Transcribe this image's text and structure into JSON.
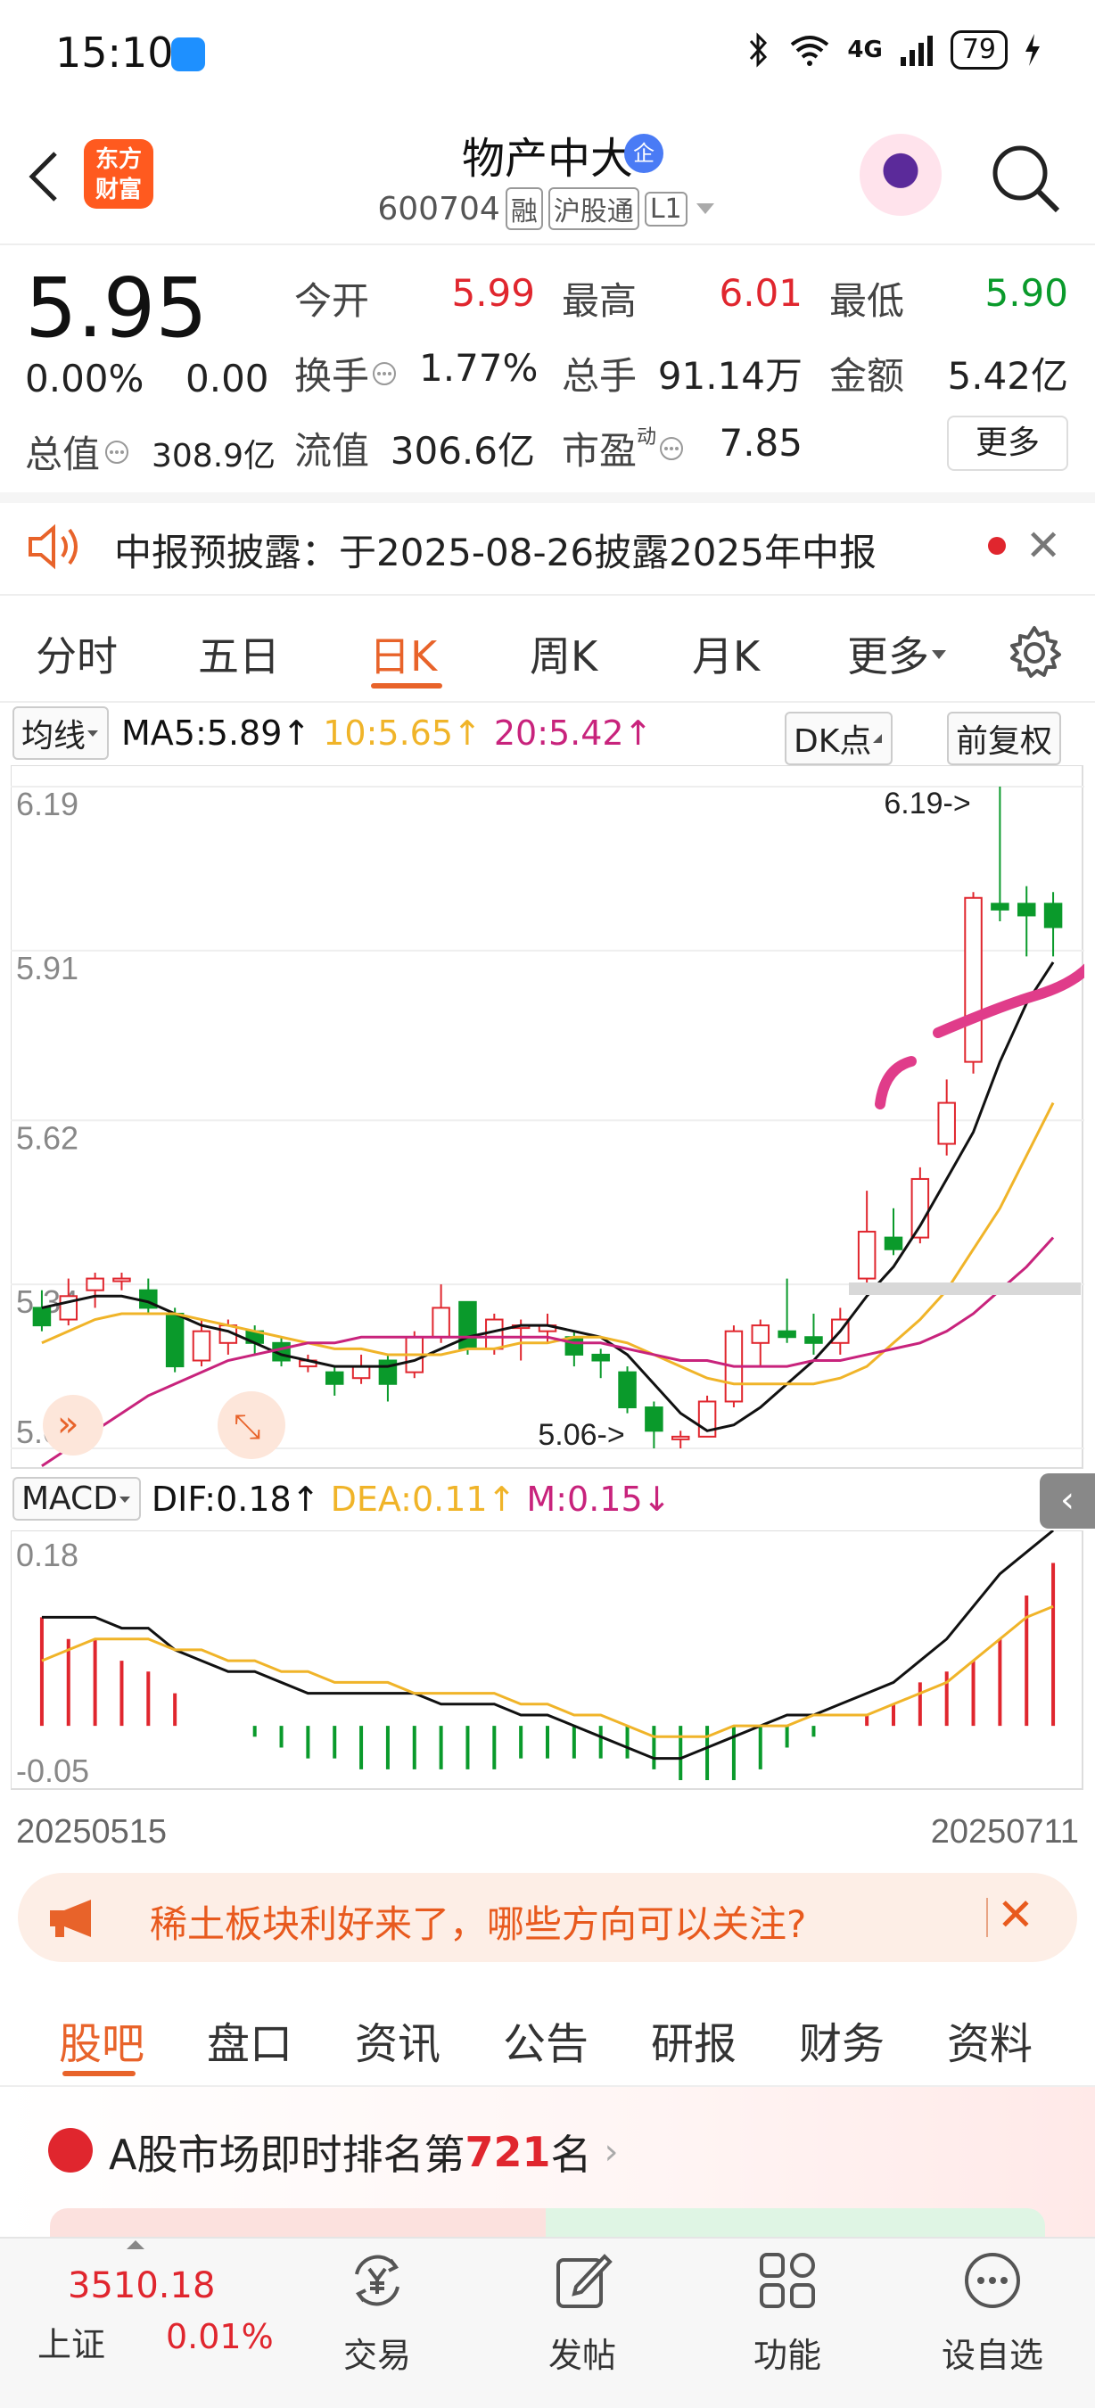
{
  "status_bar": {
    "time": "15:10",
    "network": "4G",
    "battery": "79"
  },
  "header": {
    "logo_line1": "东方",
    "logo_line2": "财富",
    "stock_name": "物产中大",
    "ent_badge": "企",
    "stock_code": "600704",
    "tags": [
      "融",
      "沪股通",
      "L1"
    ]
  },
  "quote": {
    "price": "5.95",
    "change_pct": "0.00%",
    "change_amt": "0.00",
    "open_label": "今开",
    "open": "5.99",
    "high_label": "最高",
    "high": "6.01",
    "low_label": "最低",
    "low": "5.90",
    "turnover_label": "换手",
    "turnover": "1.77%",
    "volume_label": "总手",
    "volume": "91.14万",
    "amount_label": "金额",
    "amount": "5.42亿",
    "total_cap_label": "总值",
    "total_cap": "308.9亿",
    "float_cap_label": "流值",
    "float_cap": "306.6亿",
    "pe_label": "市盈",
    "pe_sup": "动",
    "pe": "7.85",
    "more": "更多"
  },
  "notice": {
    "text": "中报预披露：于2025-08-26披露2025年中报"
  },
  "period_tabs": [
    "分时",
    "五日",
    "日K",
    "周K",
    "月K",
    "更多"
  ],
  "period_active": "日K",
  "ma_bar": {
    "selector": "均线",
    "ma5": "MA5:5.89↑",
    "ma10": "10:5.65↑",
    "ma20": "20:5.42↑",
    "dk": "DK点",
    "adjust": "前复权"
  },
  "colors": {
    "up": "#e0262e",
    "down": "#0a9a2b",
    "ma5": "#111111",
    "ma10": "#f0b429",
    "ma20": "#c8237c",
    "accent": "#e8632a"
  },
  "chart_data": [
    {
      "type": "candlestick",
      "title": "日K",
      "y_ticks": [
        "6.19",
        "5.91",
        "5.62",
        "5.34",
        "5.06"
      ],
      "ylim": [
        5.06,
        6.19
      ],
      "annotations": [
        "6.19->",
        "5.06->"
      ],
      "x_range_labels": [
        "20250515",
        "20250711"
      ],
      "candles": [
        {
          "o": 5.3,
          "c": 5.27,
          "h": 5.33,
          "l": 5.26
        },
        {
          "o": 5.28,
          "c": 5.32,
          "h": 5.35,
          "l": 5.27
        },
        {
          "o": 5.33,
          "c": 5.35,
          "h": 5.36,
          "l": 5.3
        },
        {
          "o": 5.35,
          "c": 5.35,
          "h": 5.36,
          "l": 5.33
        },
        {
          "o": 5.33,
          "c": 5.3,
          "h": 5.35,
          "l": 5.29
        },
        {
          "o": 5.29,
          "c": 5.2,
          "h": 5.3,
          "l": 5.19
        },
        {
          "o": 5.21,
          "c": 5.26,
          "h": 5.28,
          "l": 5.2
        },
        {
          "o": 5.24,
          "c": 5.27,
          "h": 5.28,
          "l": 5.22
        },
        {
          "o": 5.26,
          "c": 5.24,
          "h": 5.27,
          "l": 5.22
        },
        {
          "o": 5.24,
          "c": 5.21,
          "h": 5.25,
          "l": 5.2
        },
        {
          "o": 5.2,
          "c": 5.21,
          "h": 5.22,
          "l": 5.19
        },
        {
          "o": 5.19,
          "c": 5.17,
          "h": 5.2,
          "l": 5.15
        },
        {
          "o": 5.18,
          "c": 5.2,
          "h": 5.22,
          "l": 5.17
        },
        {
          "o": 5.21,
          "c": 5.17,
          "h": 5.22,
          "l": 5.14
        },
        {
          "o": 5.19,
          "c": 5.25,
          "h": 5.26,
          "l": 5.18
        },
        {
          "o": 5.25,
          "c": 5.3,
          "h": 5.34,
          "l": 5.24
        },
        {
          "o": 5.31,
          "c": 5.23,
          "h": 5.31,
          "l": 5.22
        },
        {
          "o": 5.23,
          "c": 5.28,
          "h": 5.29,
          "l": 5.22
        },
        {
          "o": 5.27,
          "c": 5.27,
          "h": 5.28,
          "l": 5.21
        },
        {
          "o": 5.26,
          "c": 5.27,
          "h": 5.29,
          "l": 5.24
        },
        {
          "o": 5.25,
          "c": 5.22,
          "h": 5.26,
          "l": 5.2
        },
        {
          "o": 5.22,
          "c": 5.21,
          "h": 5.23,
          "l": 5.18
        },
        {
          "o": 5.19,
          "c": 5.13,
          "h": 5.2,
          "l": 5.12
        },
        {
          "o": 5.13,
          "c": 5.09,
          "h": 5.14,
          "l": 5.06
        },
        {
          "o": 5.08,
          "c": 5.08,
          "h": 5.09,
          "l": 5.06
        },
        {
          "o": 5.08,
          "c": 5.14,
          "h": 5.15,
          "l": 5.08
        },
        {
          "o": 5.14,
          "c": 5.26,
          "h": 5.27,
          "l": 5.13
        },
        {
          "o": 5.24,
          "c": 5.27,
          "h": 5.28,
          "l": 5.2
        },
        {
          "o": 5.26,
          "c": 5.25,
          "h": 5.35,
          "l": 5.24
        },
        {
          "o": 5.25,
          "c": 5.24,
          "h": 5.29,
          "l": 5.22
        },
        {
          "o": 5.24,
          "c": 5.28,
          "h": 5.3,
          "l": 5.22
        },
        {
          "o": 5.35,
          "c": 5.43,
          "h": 5.5,
          "l": 5.33
        },
        {
          "o": 5.42,
          "c": 5.4,
          "h": 5.47,
          "l": 5.39
        },
        {
          "o": 5.42,
          "c": 5.52,
          "h": 5.54,
          "l": 5.41
        },
        {
          "o": 5.58,
          "c": 5.65,
          "h": 5.69,
          "l": 5.56
        },
        {
          "o": 5.72,
          "c": 6.0,
          "h": 6.01,
          "l": 5.7
        },
        {
          "o": 5.99,
          "c": 5.98,
          "h": 6.19,
          "l": 5.96
        },
        {
          "o": 5.99,
          "c": 5.97,
          "h": 6.02,
          "l": 5.9
        },
        {
          "o": 5.99,
          "c": 5.95,
          "h": 6.01,
          "l": 5.9
        }
      ],
      "series": [
        {
          "name": "MA5",
          "values": [
            5.3,
            5.31,
            5.32,
            5.32,
            5.31,
            5.29,
            5.27,
            5.26,
            5.24,
            5.22,
            5.21,
            5.2,
            5.2,
            5.2,
            5.21,
            5.23,
            5.25,
            5.26,
            5.27,
            5.27,
            5.26,
            5.25,
            5.22,
            5.17,
            5.12,
            5.09,
            5.1,
            5.13,
            5.17,
            5.21,
            5.26,
            5.32,
            5.37,
            5.44,
            5.52,
            5.6,
            5.72,
            5.82,
            5.89
          ]
        },
        {
          "name": "10",
          "values": [
            5.24,
            5.26,
            5.28,
            5.29,
            5.29,
            5.29,
            5.28,
            5.27,
            5.26,
            5.25,
            5.24,
            5.23,
            5.23,
            5.22,
            5.22,
            5.22,
            5.23,
            5.23,
            5.24,
            5.24,
            5.25,
            5.25,
            5.24,
            5.22,
            5.2,
            5.18,
            5.17,
            5.17,
            5.17,
            5.17,
            5.18,
            5.2,
            5.24,
            5.28,
            5.33,
            5.4,
            5.47,
            5.56,
            5.65
          ]
        },
        {
          "name": "20",
          "values": [
            5.03,
            5.06,
            5.09,
            5.12,
            5.15,
            5.17,
            5.19,
            5.21,
            5.22,
            5.23,
            5.24,
            5.24,
            5.25,
            5.25,
            5.25,
            5.25,
            5.25,
            5.25,
            5.25,
            5.25,
            5.24,
            5.24,
            5.23,
            5.22,
            5.21,
            5.21,
            5.2,
            5.2,
            5.2,
            5.21,
            5.21,
            5.22,
            5.23,
            5.24,
            5.26,
            5.29,
            5.33,
            5.37,
            5.42
          ]
        }
      ]
    },
    {
      "type": "bar",
      "title": "MACD",
      "y_ticks": [
        "0.18",
        "-0.05"
      ],
      "ylim": [
        -0.05,
        0.18
      ],
      "indicators": {
        "dif": "DIF:0.18↑",
        "dea": "DEA:0.11↑",
        "m": "M:0.15↓"
      },
      "x_range_labels": [
        "20250515",
        "20250711"
      ],
      "hist": [
        0.1,
        0.08,
        0.08,
        0.06,
        0.05,
        0.03,
        0.0,
        0.0,
        -0.01,
        -0.02,
        -0.03,
        -0.03,
        -0.04,
        -0.04,
        -0.04,
        -0.04,
        -0.04,
        -0.04,
        -0.03,
        -0.03,
        -0.03,
        -0.03,
        -0.03,
        -0.04,
        -0.05,
        -0.05,
        -0.05,
        -0.04,
        -0.02,
        -0.01,
        0.0,
        0.01,
        0.02,
        0.04,
        0.05,
        0.06,
        0.08,
        0.12,
        0.15
      ],
      "series": [
        {
          "name": "DIF",
          "values": [
            0.1,
            0.1,
            0.1,
            0.09,
            0.09,
            0.07,
            0.06,
            0.05,
            0.05,
            0.04,
            0.03,
            0.03,
            0.03,
            0.03,
            0.03,
            0.02,
            0.02,
            0.02,
            0.01,
            0.01,
            0.0,
            -0.01,
            -0.02,
            -0.03,
            -0.03,
            -0.02,
            -0.01,
            0.0,
            0.01,
            0.01,
            0.02,
            0.03,
            0.04,
            0.06,
            0.08,
            0.11,
            0.14,
            0.16,
            0.18
          ]
        },
        {
          "name": "DEA",
          "values": [
            0.06,
            0.07,
            0.08,
            0.08,
            0.08,
            0.07,
            0.07,
            0.06,
            0.06,
            0.05,
            0.05,
            0.04,
            0.04,
            0.04,
            0.03,
            0.03,
            0.03,
            0.03,
            0.02,
            0.02,
            0.01,
            0.01,
            0.0,
            -0.01,
            -0.01,
            -0.01,
            0.0,
            0.0,
            0.0,
            0.01,
            0.01,
            0.01,
            0.02,
            0.03,
            0.04,
            0.06,
            0.08,
            0.1,
            0.11
          ]
        }
      ]
    }
  ],
  "promo": {
    "text": "稀土板块利好来了，哪些方向可以关注?"
  },
  "bottom_tabs": [
    "股吧",
    "盘口",
    "资讯",
    "公告",
    "研报",
    "财务",
    "资料"
  ],
  "bottom_active": "股吧",
  "rank": {
    "prefix": "A股市场即时排名第",
    "number": "721",
    "suffix": "名"
  },
  "nav": {
    "index_value": "3510.18",
    "index_name": "上证",
    "index_change": "0.01%",
    "items": [
      {
        "label": "交易",
        "icon": "yuan-cycle-icon"
      },
      {
        "label": "发帖",
        "icon": "edit-icon"
      },
      {
        "label": "功能",
        "icon": "apps-icon"
      },
      {
        "label": "设自选",
        "icon": "more-dots-icon"
      }
    ]
  }
}
